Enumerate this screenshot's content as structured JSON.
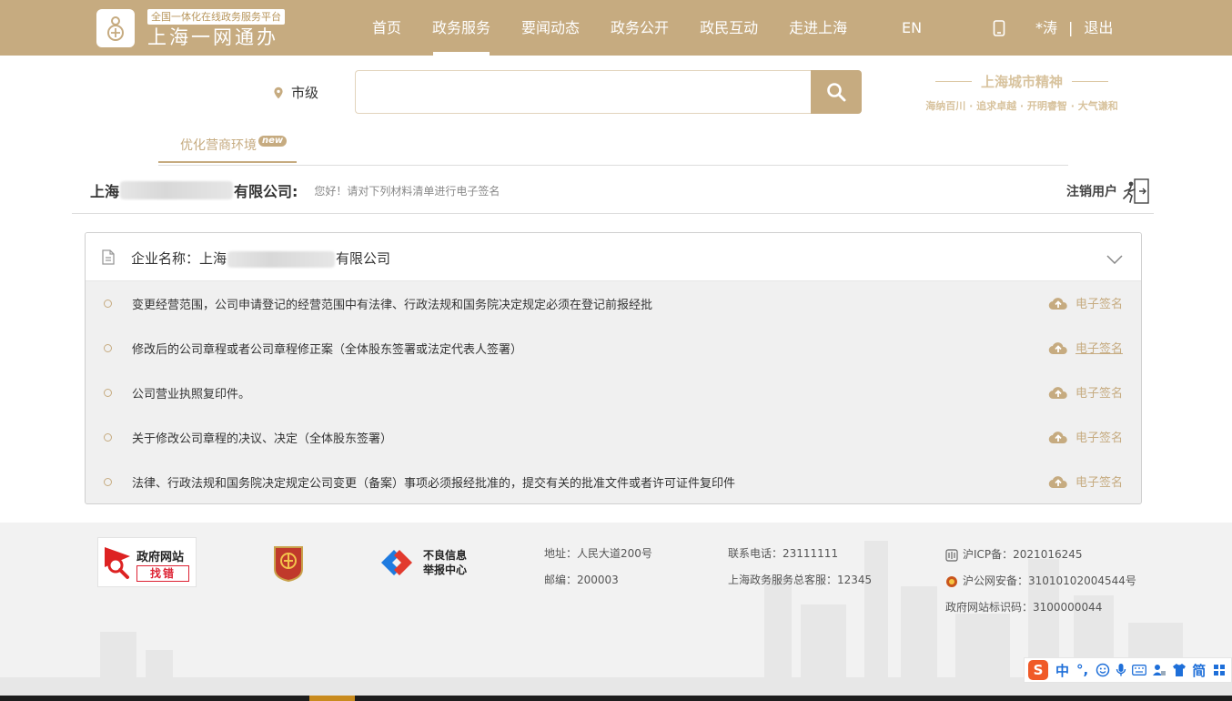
{
  "header": {
    "platform_tag": "全国一体化在线政务服务平台",
    "site_name": "上海一网通办",
    "nav": [
      {
        "label": "首页",
        "active": false
      },
      {
        "label": "政务服务",
        "active": true
      },
      {
        "label": "要闻动态",
        "active": false
      },
      {
        "label": "政务公开",
        "active": false
      },
      {
        "label": "政民互动",
        "active": false
      },
      {
        "label": "走进上海",
        "active": false
      }
    ],
    "lang": "EN",
    "user": "*涛",
    "separator": "|",
    "logout": "退出"
  },
  "search": {
    "location": "市级",
    "placeholder": "",
    "spirit_title": "上海城市精神",
    "spirit_sub": "海纳百川 · 追求卓越 · 开明睿智 · 大气谦和"
  },
  "tabs": {
    "optimize_label": "优化营商环境",
    "new_badge": "new"
  },
  "company": {
    "name_prefix": "上海",
    "name_suffix": "有限公司:",
    "greeting": "您好！请对下列材料清单进行电子签名",
    "logout_label": "注销用户"
  },
  "panel": {
    "title_label": "企业名称：",
    "title_prefix": "上海",
    "title_suffix": "有限公司",
    "items": [
      {
        "text": "变更经营范围，公司申请登记的经营范围中有法律、行政法规和国务院决定规定必须在登记前报经批",
        "action": "电子签名",
        "underlined": false
      },
      {
        "text": "修改后的公司章程或者公司章程修正案（全体股东签署或法定代表人签署）",
        "action": "电子签名",
        "underlined": true
      },
      {
        "text": "公司营业执照复印件。",
        "action": "电子签名",
        "underlined": false
      },
      {
        "text": "关于修改公司章程的决议、决定（全体股东签署）",
        "action": "电子签名",
        "underlined": false
      },
      {
        "text": "法律、行政法规和国务院决定规定公司变更（备案）事项必须报经批准的，提交有关的批准文件或者许可证件复印件",
        "action": "电子签名",
        "underlined": false
      }
    ]
  },
  "footer": {
    "gov_site_t1": "政府网站",
    "gov_site_t2": "找错",
    "report_l1": "不良信息",
    "report_l2": "举报中心",
    "address": "地址：人民大道200号",
    "postcode": "邮编：200003",
    "phone": "联系电话：23111111",
    "hotline": "上海政务服务总客服：12345",
    "icp": "沪ICP备：2021016245",
    "police": "沪公网安备：31010102004544号",
    "site_code": "政府网站标识码：3100000044"
  },
  "ime": {
    "logo": "S",
    "lang": "中",
    "punct": "°,",
    "mode": "简"
  },
  "colors": {
    "brand": "#c6ab80",
    "accent_red": "#dd2233"
  }
}
